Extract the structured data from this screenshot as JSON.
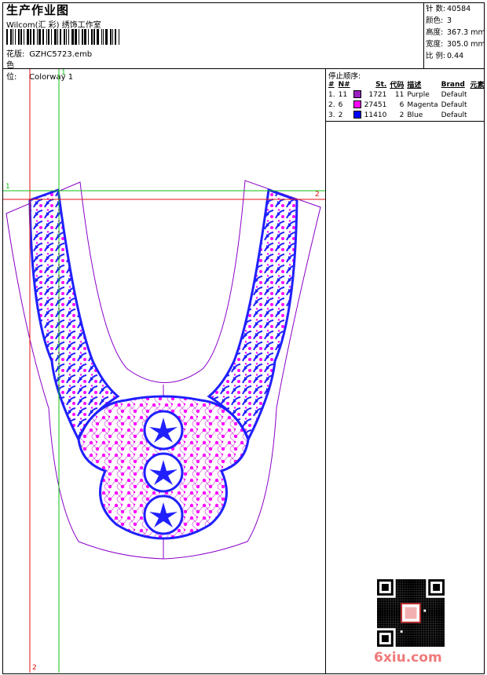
{
  "header": {
    "title": "生产作业图",
    "subtitle": "Wilcom(汇 彩) 绣饰工作室",
    "design_label": "花版:",
    "design_value": "GZHC5723.emb",
    "colorway_label": "色 位:",
    "colorway_value": "Colorway 1"
  },
  "stats": [
    {
      "label": "针 数:",
      "value": "40584"
    },
    {
      "label": "颜色:",
      "value": "3"
    },
    {
      "label": "高度:",
      "value": "367.3 mm"
    },
    {
      "label": "宽度:",
      "value": "305.0 mm"
    },
    {
      "label": "比 例:",
      "value": "0.44"
    }
  ],
  "stops": {
    "title": "停止顺序:",
    "headers": [
      "#",
      "N#",
      "St.",
      "代码",
      "描述",
      "Brand",
      "元素"
    ],
    "rows": [
      {
        "order": "1.",
        "n": "11",
        "color": "#9b1fc0",
        "st": "1721",
        "code": "11",
        "desc": "Purple",
        "brand": "Default"
      },
      {
        "order": "2.",
        "n": "6",
        "color": "#ff00ff",
        "st": "27451",
        "code": "6",
        "desc": "Magenta",
        "brand": "Default"
      },
      {
        "order": "3.",
        "n": "2",
        "color": "#0000ff",
        "st": "11410",
        "code": "2",
        "desc": "Blue",
        "brand": "Default"
      }
    ]
  },
  "guides": {
    "v1": "1",
    "v2": "2",
    "h1": "1",
    "h2": "2"
  },
  "watermark": "6xiu.com",
  "colors": {
    "outline_purple": "#8a00c8",
    "fill_magenta": "#ff00ff",
    "stitch_blue": "#1a1aff",
    "guide_red": "#e01010",
    "guide_green": "#10c010"
  }
}
